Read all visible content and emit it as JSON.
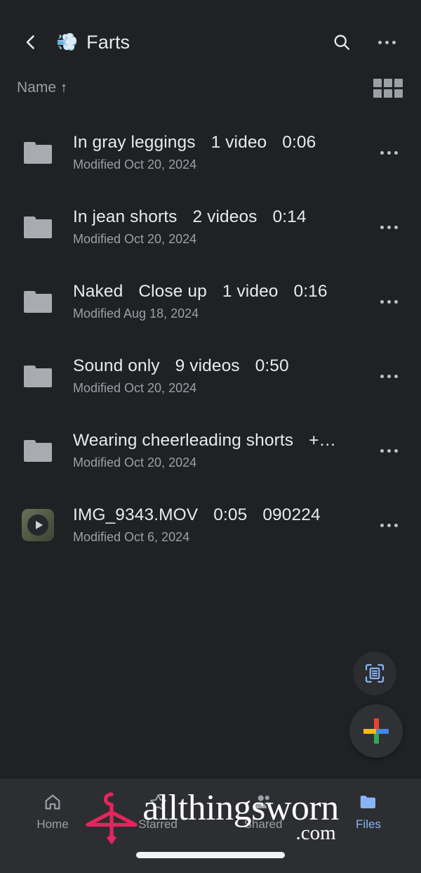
{
  "app": {
    "background_color": "#202124",
    "accent_color": "#8ab4f8"
  },
  "appbar": {
    "back_icon": "chevron-left-icon",
    "title_emoji": "💨",
    "title": "Farts",
    "search_icon": "search-icon",
    "overflow_icon": "overflow-menu-icon"
  },
  "sortbar": {
    "sort_label": "Name",
    "sort_arrow": "↑",
    "view_toggle_icon": "grid-view-icon"
  },
  "files": [
    {
      "icon": "folder-icon",
      "name": "In gray leggings",
      "count": "1 video",
      "duration": "0:06",
      "extra": "",
      "modified": "Modified Oct 20, 2024",
      "more_icon": "overflow-menu-icon"
    },
    {
      "icon": "folder-icon",
      "name": "In jean shorts",
      "count": "2 videos",
      "duration": "0:14",
      "extra": "",
      "modified": "Modified Oct 20, 2024",
      "more_icon": "overflow-menu-icon"
    },
    {
      "icon": "folder-icon",
      "name": "Naked",
      "count": "Close up",
      "duration": "1 video",
      "extra": "0:16",
      "modified": "Modified Aug 18, 2024",
      "more_icon": "overflow-menu-icon"
    },
    {
      "icon": "folder-icon",
      "name": "Sound only",
      "count": "9 videos",
      "duration": "0:50",
      "extra": "",
      "modified": "Modified Oct 20, 2024",
      "more_icon": "overflow-menu-icon"
    },
    {
      "icon": "folder-icon",
      "name": "Wearing cheerleading shorts",
      "count": "+…",
      "duration": "",
      "extra": "",
      "modified": "Modified Oct 20, 2024",
      "more_icon": "overflow-menu-icon"
    },
    {
      "icon": "video-thumbnail-icon",
      "name": "IMG_9343.MOV",
      "count": "0:05",
      "duration": "090224",
      "extra": "",
      "modified": "Modified Oct 6, 2024",
      "more_icon": "overflow-menu-icon"
    }
  ],
  "fabs": {
    "scan_icon": "document-scan-icon",
    "add_icon": "google-plus-icon"
  },
  "bottom_nav": [
    {
      "icon": "home-icon",
      "label": "Home",
      "active": false
    },
    {
      "icon": "star-icon",
      "label": "Starred",
      "active": false
    },
    {
      "icon": "people-icon",
      "label": "Shared",
      "active": false
    },
    {
      "icon": "folder-icon",
      "label": "Files",
      "active": true
    }
  ],
  "watermark": {
    "logo_icon": "hanger-logo-icon",
    "logo_color": "#e6245f",
    "text": "allthingsworn",
    "suffix": ".com"
  }
}
